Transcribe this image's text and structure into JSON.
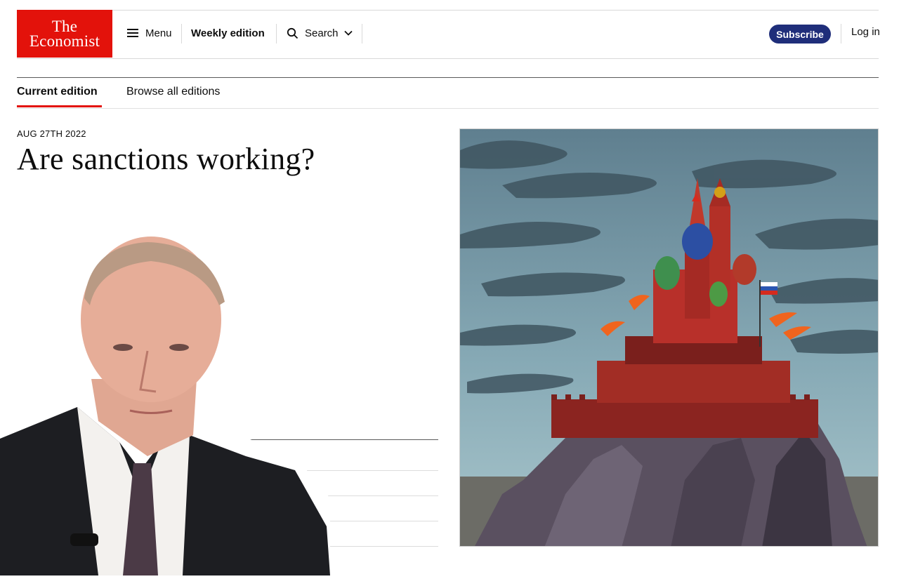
{
  "brand": {
    "logo_line1": "The",
    "logo_line2": "Economist",
    "color": "#e3120b"
  },
  "nav": {
    "menu_label": "Menu",
    "weekly_label": "Weekly edition",
    "search_label": "Search",
    "subscribe_label": "Subscribe",
    "login_label": "Log in",
    "subscribe_color": "#1f2e7a"
  },
  "tabs": [
    {
      "label": "Current edition",
      "active": true
    },
    {
      "label": "Browse all editions",
      "active": false
    }
  ],
  "edition": {
    "date": "AUG 27TH 2022",
    "headline": "Are sanctions working?"
  },
  "icons": [
    "menu-icon",
    "search-icon",
    "chevron-down-icon"
  ],
  "images": [
    "cover-illustration-kremlin",
    "portrait-man-in-suit"
  ]
}
